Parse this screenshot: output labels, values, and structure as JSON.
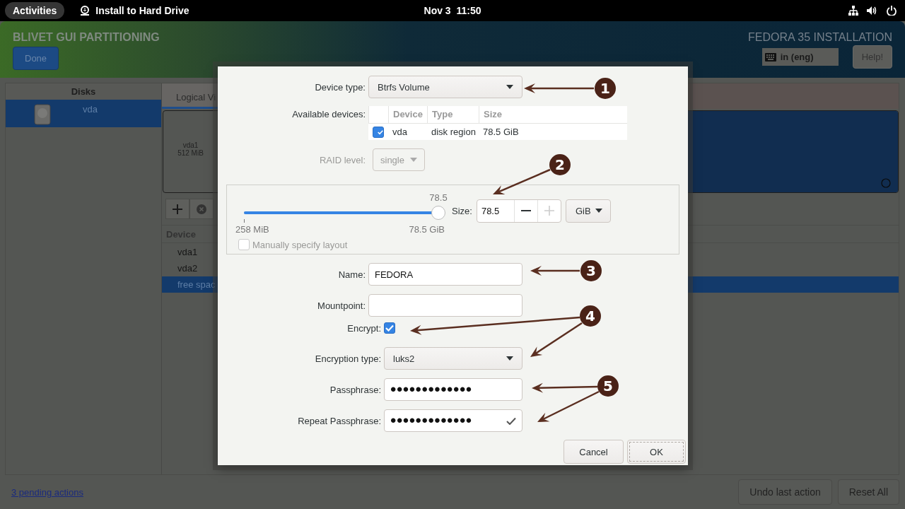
{
  "top_bar": {
    "activities": "Activities",
    "app_title": "Install to Hard Drive",
    "clock": "Nov 3  11:50"
  },
  "header": {
    "title": "BLIVET GUI PARTITIONING",
    "done_button": "Done",
    "product": "FEDORA 35 INSTALLATION",
    "keyboard_layout": "in (eng)",
    "help_button": "Help!"
  },
  "disks_panel": {
    "heading": "Disks",
    "items": [
      {
        "name": "vda",
        "selected": true
      }
    ]
  },
  "tabs": [
    {
      "label": "Logical Vi",
      "selected": true
    }
  ],
  "partition_map": [
    {
      "name": "vda1",
      "size": "512 MiB"
    }
  ],
  "device_list": {
    "columns": [
      "Device"
    ],
    "rows": [
      {
        "device": "vda1",
        "selected": false
      },
      {
        "device": "vda2",
        "selected": false
      },
      {
        "device": "free spac",
        "selected": true
      }
    ]
  },
  "footer": {
    "pending_link": "3 pending actions",
    "buttons": [
      "Undo last action",
      "Reset All"
    ]
  },
  "dialog": {
    "device_type": {
      "label": "Device type:",
      "value": "Btrfs Volume"
    },
    "available_devices": {
      "label": "Available devices:",
      "columns": [
        "Device",
        "Type",
        "Size"
      ],
      "rows": [
        {
          "checked": true,
          "device": "vda",
          "type": "disk region",
          "size": "78.5 GiB"
        }
      ]
    },
    "raid_level": {
      "label": "RAID level:",
      "value": "single",
      "disabled": true
    },
    "size": {
      "slider_value": "78.5",
      "level": 1,
      "min_label": "258 MiB",
      "max_label": "78.5 GiB",
      "label": "Size:",
      "value": "78.5",
      "decrease_disabled": false,
      "increase_disabled": true,
      "unit": "GiB"
    },
    "manual_layout": {
      "label": "Manually specify layout",
      "checked": false,
      "disabled": true
    },
    "fields": [
      {
        "kind": "entry",
        "label": "Name:",
        "value": "FEDORA"
      },
      {
        "kind": "entry",
        "label": "Mountpoint:"
      }
    ],
    "encryption_fields": [
      {
        "kind": "checkbox",
        "label": "Encrypt:",
        "checked": true
      },
      {
        "kind": "select",
        "label": "Encryption type:",
        "value": "luks2"
      },
      {
        "kind": "password",
        "label": "Passphrase:",
        "value": "•••••••••••••",
        "confirmed": false
      },
      {
        "kind": "password",
        "label": "Repeat Passphrase:",
        "value": "•••••••••••••",
        "confirmed": true
      }
    ],
    "buttons": [
      {
        "label": "Cancel",
        "focused": false
      },
      {
        "label": "OK",
        "focused": true
      }
    ]
  },
  "callouts": [
    {
      "number": "1"
    },
    {
      "number": "2"
    },
    {
      "number": "3"
    },
    {
      "number": "4"
    },
    {
      "number": "5"
    }
  ]
}
